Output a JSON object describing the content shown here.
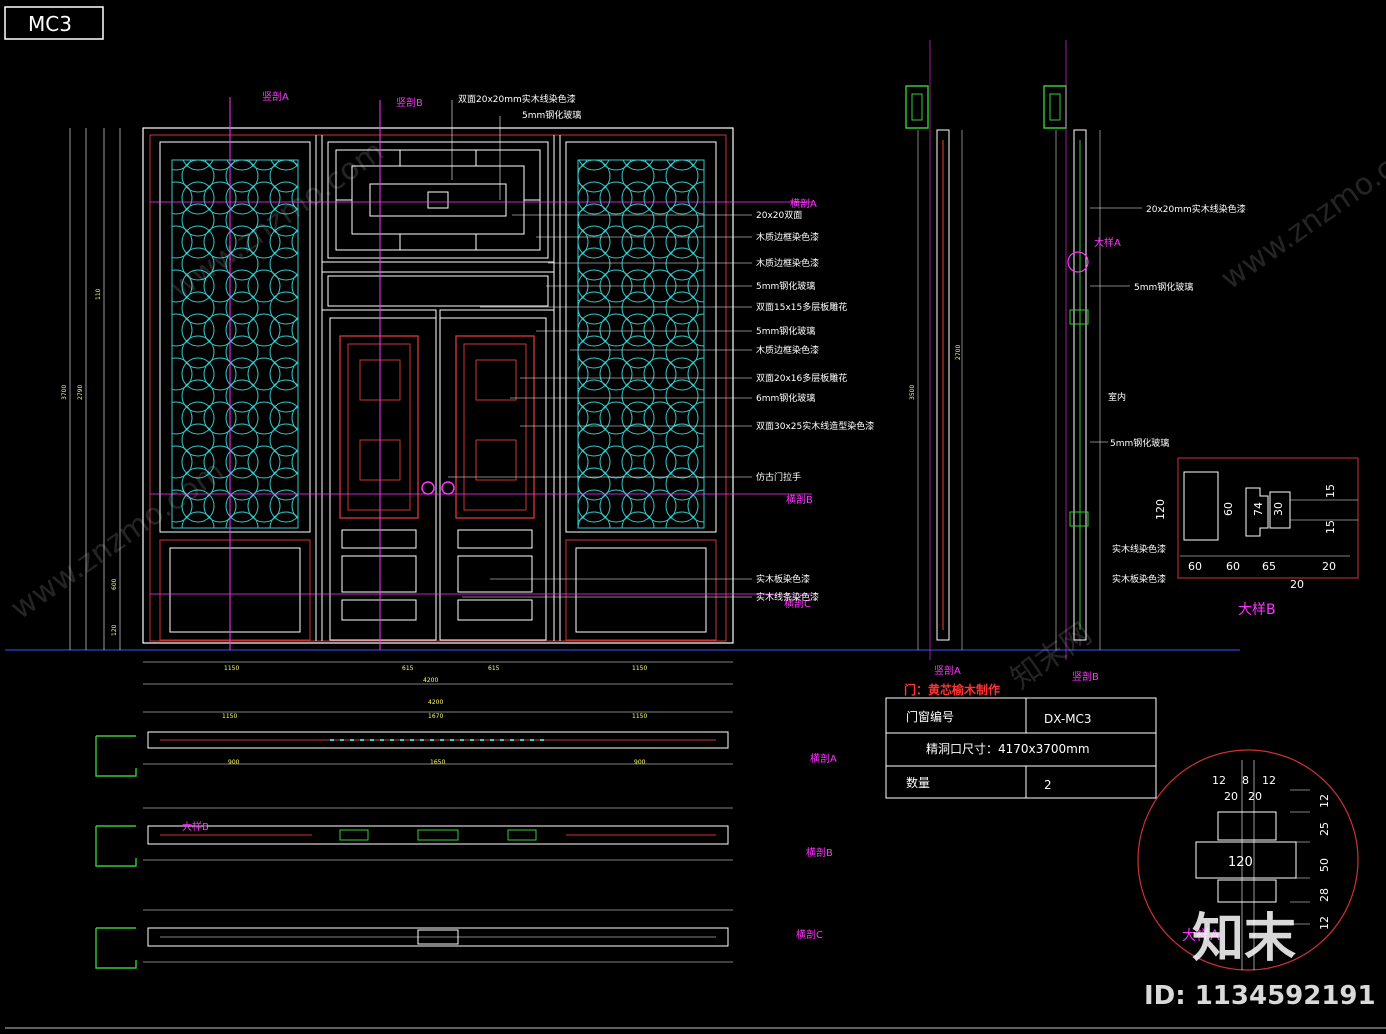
{
  "sheet_title": "MC3",
  "section_marks": {
    "vertical_a": "竖剖A",
    "vertical_b": "竖剖B",
    "horizontal_a": "横剖A",
    "horizontal_b": "横剖B",
    "horizontal_c": "横剖C"
  },
  "callouts_top": [
    "双面20x20mm实木线染色漆",
    "5mm钢化玻璃"
  ],
  "callouts_right": [
    "20x20双面",
    "木质边框染色漆",
    "木质边框染色漆",
    "5mm钢化玻璃",
    "双面15x15多层板雕花",
    "5mm钢化玻璃",
    "木质边框染色漆",
    "双面20x16多层板雕花",
    "6mm钢化玻璃",
    "双面30x25实木线造型染色漆",
    "仿古门拉手",
    "实木板染色漆",
    "实木线条染色漆"
  ],
  "section_callouts": {
    "glass_frame": "20x20mm实木线染色漆",
    "detail_a": "大样A",
    "glass_1": "5mm钢化玻璃",
    "indoor": "室内",
    "glass_2": "5mm钢化玻璃",
    "wood_line": "实木线染色漆",
    "wood_board": "实木板染色漆"
  },
  "detail_b": {
    "label": "大样B",
    "dims_bottom": [
      "60",
      "60",
      "65",
      "20"
    ],
    "dims_bottom2": "20",
    "dims_left": "120",
    "dims_right": [
      "15",
      "15"
    ],
    "dims_mid": [
      "60",
      "74",
      "30"
    ]
  },
  "detail_a2": {
    "label": "大样A",
    "dims_top": [
      "12",
      "8",
      "12"
    ],
    "dims_top2": [
      "20",
      "20"
    ],
    "dims_right": [
      "12",
      "25",
      "50",
      "28",
      "12"
    ],
    "center": "120"
  },
  "material_note": "门：黄芯榆木制作",
  "table": {
    "rows": [
      {
        "label": "门窗编号",
        "value": "DX-MC3"
      },
      {
        "label": "精洞口尺寸：4170x3700mm",
        "value": ""
      },
      {
        "label": "数量",
        "value": "2"
      }
    ]
  },
  "plan_labels": {
    "detail_b_tag": "大样B"
  },
  "dims": {
    "overall_width": "4200",
    "overall_width2": "4200",
    "seg": [
      "1150",
      "615",
      "615",
      "1150"
    ],
    "plan_seg": [
      "1150",
      "1670",
      "1150"
    ],
    "plan_seg2": [
      "900",
      "1650",
      "900"
    ],
    "left_total": "3700",
    "left_segs": [
      "110",
      "2790",
      "600",
      "120"
    ],
    "section_total": "3500",
    "section_h": "2700"
  },
  "watermarks": {
    "site": "www.znzmo.com",
    "brand": "知末网",
    "logo": "知末",
    "id": "ID: 1134592191"
  }
}
